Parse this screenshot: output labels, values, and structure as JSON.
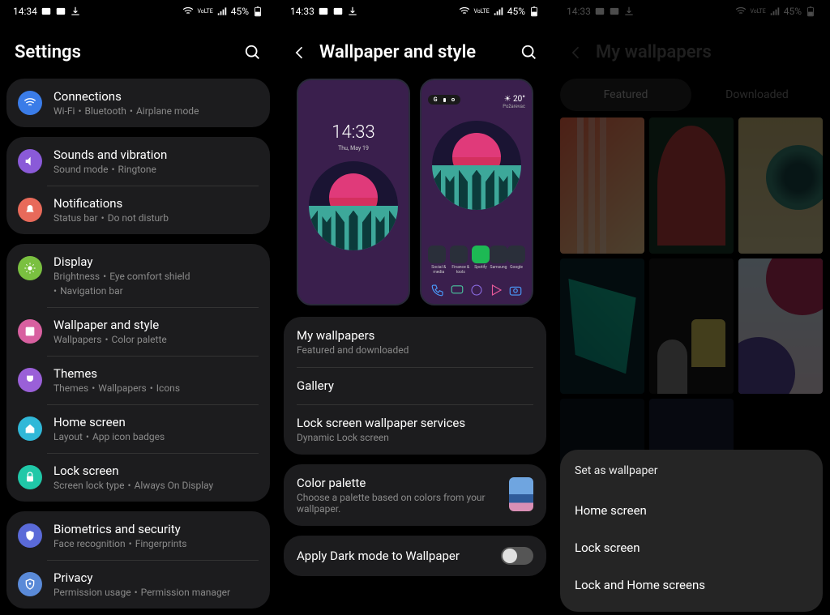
{
  "panel1": {
    "status": {
      "time": "14:34",
      "battery": "45%",
      "lte": "VoLTE"
    },
    "title": "Settings",
    "groups": [
      {
        "rows": [
          {
            "icon_color": "#3a7ce8",
            "icon": "wifi",
            "title": "Connections",
            "sub": [
              "Wi-Fi",
              "Bluetooth",
              "Airplane mode"
            ]
          }
        ]
      },
      {
        "rows": [
          {
            "icon_color": "#8a5ad8",
            "icon": "sound",
            "title": "Sounds and vibration",
            "sub": [
              "Sound mode",
              "Ringtone"
            ]
          },
          {
            "icon_color": "#e86a5a",
            "icon": "bell",
            "title": "Notifications",
            "sub": [
              "Status bar",
              "Do not disturb"
            ]
          }
        ]
      },
      {
        "rows": [
          {
            "icon_color": "#7ac040",
            "icon": "display",
            "title": "Display",
            "sub": [
              "Brightness",
              "Eye comfort shield",
              "Navigation bar"
            ]
          },
          {
            "icon_color": "#d860a0",
            "icon": "wallpaper",
            "title": "Wallpaper and style",
            "sub": [
              "Wallpapers",
              "Color palette"
            ]
          },
          {
            "icon_color": "#9a60d8",
            "icon": "themes",
            "title": "Themes",
            "sub": [
              "Themes",
              "Wallpapers",
              "Icons"
            ]
          },
          {
            "icon_color": "#30b8d8",
            "icon": "home",
            "title": "Home screen",
            "sub": [
              "Layout",
              "App icon badges"
            ]
          },
          {
            "icon_color": "#20c8a8",
            "icon": "lock",
            "title": "Lock screen",
            "sub": [
              "Screen lock type",
              "Always On Display"
            ]
          }
        ]
      },
      {
        "rows": [
          {
            "icon_color": "#5a6ad8",
            "icon": "shield",
            "title": "Biometrics and security",
            "sub": [
              "Face recognition",
              "Fingerprints"
            ]
          },
          {
            "icon_color": "#5a8ad8",
            "icon": "privacy",
            "title": "Privacy",
            "sub": [
              "Permission usage",
              "Permission manager"
            ]
          }
        ]
      }
    ]
  },
  "panel2": {
    "status": {
      "time": "14:33",
      "battery": "45%",
      "lte": "VoLTE"
    },
    "title": "Wallpaper and style",
    "previews": {
      "lock": {
        "clock": "14:33",
        "date": "Thu, May 19"
      },
      "home": {
        "temp": "20°",
        "city": "Požarevac",
        "folders": [
          "Social & media",
          "Finance & tools",
          "Spotify",
          "Samsung",
          "Google"
        ]
      }
    },
    "list1": [
      {
        "title": "My wallpapers",
        "sub": "Featured and downloaded"
      },
      {
        "title": "Gallery",
        "sub": ""
      },
      {
        "title": "Lock screen wallpaper services",
        "sub": "Dynamic Lock screen"
      }
    ],
    "palette": {
      "title": "Color palette",
      "sub": "Choose a palette based on colors from your wallpaper."
    },
    "darkmode": {
      "label": "Apply Dark mode to Wallpaper"
    }
  },
  "panel3": {
    "status": {
      "time": "14:33",
      "battery": "45%",
      "lte": "VoLTE"
    },
    "title": "My wallpapers",
    "tabs": {
      "featured": "Featured",
      "downloaded": "Downloaded"
    },
    "sheet": {
      "title": "Set as wallpaper",
      "options": [
        "Home screen",
        "Lock screen",
        "Lock and Home screens"
      ]
    }
  }
}
